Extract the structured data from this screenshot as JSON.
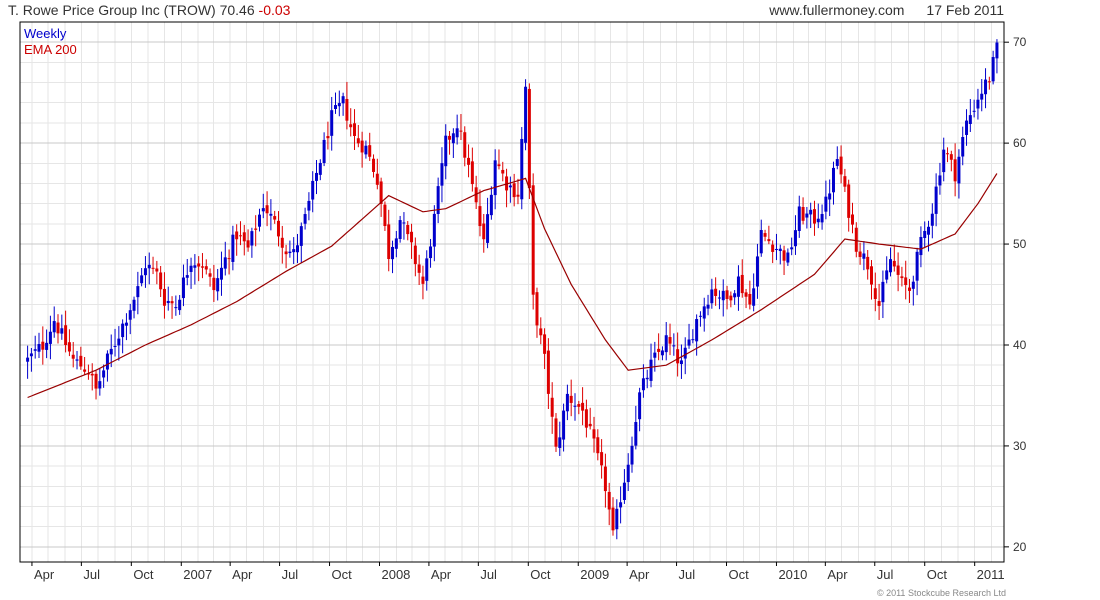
{
  "header": {
    "company": "T. Rowe Price Group Inc (TROW)",
    "price": "70.46",
    "change": "-0.03",
    "site": "www.fullermoney.com",
    "date": "17 Feb 2011"
  },
  "credit": "© 2011 Stockcube Research Ltd",
  "colors": {
    "up": "#0000cc",
    "down": "#dd0000",
    "ema": "#990000",
    "grid_major": "#c8c8c8",
    "grid_minor": "#e6e6e6",
    "axis": "#000000"
  },
  "chart_data": {
    "type": "candlestick",
    "interval": "Weekly",
    "legend": [
      {
        "label": "Weekly",
        "color": "#0000cc"
      },
      {
        "label": "EMA 200",
        "color": "#cc0000"
      }
    ],
    "y_range": [
      18.5,
      72
    ],
    "y_ticks": [
      20,
      30,
      40,
      50,
      60,
      70
    ],
    "x_tick_labels": [
      "Apr",
      "Jul",
      "Oct",
      "2007",
      "Apr",
      "Jul",
      "Oct",
      "2008",
      "Apr",
      "Jul",
      "Oct",
      "2009",
      "Apr",
      "Jul",
      "Oct",
      "2010",
      "Apr",
      "Jul",
      "Oct",
      "2011"
    ],
    "price_path_anchors": [
      [
        "2006-03-24",
        38.5
      ],
      [
        "2006-04-21",
        40.0
      ],
      [
        "2006-05-12",
        42.5
      ],
      [
        "2006-06-16",
        38.5
      ],
      [
        "2006-07-14",
        37.5
      ],
      [
        "2006-07-28",
        35.5
      ],
      [
        "2006-08-18",
        38.5
      ],
      [
        "2006-09-15",
        42.0
      ],
      [
        "2006-10-13",
        45.5
      ],
      [
        "2006-10-27",
        48.0
      ],
      [
        "2006-11-17",
        47.0
      ],
      [
        "2006-12-01",
        44.5
      ],
      [
        "2006-12-22",
        44.0
      ],
      [
        "2007-01-19",
        48.5
      ],
      [
        "2007-02-09",
        48.0
      ],
      [
        "2007-03-02",
        45.5
      ],
      [
        "2007-03-23",
        48.5
      ],
      [
        "2007-04-13",
        51.0
      ],
      [
        "2007-05-04",
        49.5
      ],
      [
        "2007-06-01",
        54.0
      ],
      [
        "2007-06-22",
        52.0
      ],
      [
        "2007-07-13",
        49.5
      ],
      [
        "2007-07-27",
        49.0
      ],
      [
        "2007-08-17",
        52.5
      ],
      [
        "2007-09-07",
        57.0
      ],
      [
        "2007-10-05",
        62.5
      ],
      [
        "2007-10-26",
        64.0
      ],
      [
        "2007-11-16",
        60.5
      ],
      [
        "2007-12-07",
        59.5
      ],
      [
        "2007-12-28",
        56.5
      ],
      [
        "2008-01-18",
        49.0
      ],
      [
        "2008-02-08",
        52.5
      ],
      [
        "2008-02-29",
        49.5
      ],
      [
        "2008-03-21",
        46.0
      ],
      [
        "2008-04-11",
        52.5
      ],
      [
        "2008-05-02",
        60.0
      ],
      [
        "2008-05-23",
        62.0
      ],
      [
        "2008-06-13",
        57.5
      ],
      [
        "2008-07-11",
        50.0
      ],
      [
        "2008-08-01",
        58.5
      ],
      [
        "2008-08-22",
        56.0
      ],
      [
        "2008-09-12",
        55.0
      ],
      [
        "2008-09-26",
        65.5
      ],
      [
        "2008-10-10",
        44.5
      ],
      [
        "2008-10-31",
        38.5
      ],
      [
        "2008-11-21",
        29.5
      ],
      [
        "2008-12-12",
        35.0
      ],
      [
        "2009-01-09",
        33.5
      ],
      [
        "2009-01-30",
        30.0
      ],
      [
        "2009-02-20",
        26.0
      ],
      [
        "2009-03-06",
        21.0
      ],
      [
        "2009-03-20",
        25.0
      ],
      [
        "2009-04-03",
        28.5
      ],
      [
        "2009-04-24",
        35.0
      ],
      [
        "2009-05-15",
        38.0
      ],
      [
        "2009-06-12",
        40.5
      ],
      [
        "2009-07-10",
        38.0
      ],
      [
        "2009-08-07",
        42.5
      ],
      [
        "2009-09-04",
        45.5
      ],
      [
        "2009-10-02",
        44.5
      ],
      [
        "2009-10-23",
        46.5
      ],
      [
        "2009-11-13",
        44.0
      ],
      [
        "2009-12-04",
        51.0
      ],
      [
        "2009-12-25",
        50.0
      ],
      [
        "2010-01-22",
        48.5
      ],
      [
        "2010-02-12",
        53.0
      ],
      [
        "2010-03-12",
        52.5
      ],
      [
        "2010-04-02",
        54.0
      ],
      [
        "2010-04-23",
        58.5
      ],
      [
        "2010-05-07",
        55.0
      ],
      [
        "2010-05-28",
        50.0
      ],
      [
        "2010-06-18",
        48.0
      ],
      [
        "2010-07-09",
        44.0
      ],
      [
        "2010-07-30",
        48.5
      ],
      [
        "2010-08-20",
        46.0
      ],
      [
        "2010-09-03",
        45.5
      ],
      [
        "2010-09-24",
        50.0
      ],
      [
        "2010-10-15",
        53.5
      ],
      [
        "2010-11-05",
        59.5
      ],
      [
        "2010-11-26",
        57.0
      ],
      [
        "2010-12-17",
        62.0
      ],
      [
        "2011-01-07",
        64.5
      ],
      [
        "2011-01-28",
        66.5
      ],
      [
        "2011-02-17",
        70.46
      ]
    ],
    "ema_path_anchors": [
      [
        "2006-03-24",
        34.8
      ],
      [
        "2006-07-28",
        37.5
      ],
      [
        "2006-10-27",
        40.0
      ],
      [
        "2007-01-19",
        42.0
      ],
      [
        "2007-04-13",
        44.3
      ],
      [
        "2007-07-13",
        47.3
      ],
      [
        "2007-10-05",
        49.8
      ],
      [
        "2007-12-28",
        53.8
      ],
      [
        "2008-01-18",
        54.8
      ],
      [
        "2008-03-21",
        53.2
      ],
      [
        "2008-05-02",
        53.5
      ],
      [
        "2008-07-11",
        55.3
      ],
      [
        "2008-09-26",
        56.5
      ],
      [
        "2008-10-31",
        51.5
      ],
      [
        "2008-12-19",
        46.0
      ],
      [
        "2009-02-20",
        40.5
      ],
      [
        "2009-04-03",
        37.5
      ],
      [
        "2009-06-12",
        38.0
      ],
      [
        "2009-09-04",
        40.5
      ],
      [
        "2009-12-04",
        43.5
      ],
      [
        "2010-03-12",
        47.0
      ],
      [
        "2010-05-07",
        50.5
      ],
      [
        "2010-07-09",
        50.0
      ],
      [
        "2010-09-24",
        49.5
      ],
      [
        "2010-11-26",
        51.0
      ],
      [
        "2011-01-07",
        54.0
      ],
      [
        "2011-02-17",
        57.5
      ]
    ]
  }
}
